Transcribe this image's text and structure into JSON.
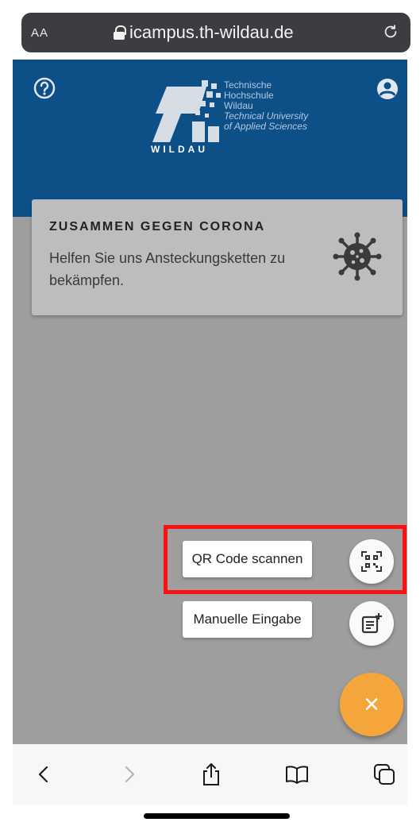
{
  "browser": {
    "text_size_button": "AA",
    "url": "icampus.th-wildau.de"
  },
  "header": {
    "logo_lines": [
      "Technische",
      "Hochschule",
      "Wildau",
      "Technical University",
      "of Applied Sciences"
    ],
    "logo_wordmark": "WILDAU"
  },
  "card": {
    "title": "ZUSAMMEN GEGEN CORONA",
    "text": "Helfen Sie uns Ansteckungsketten zu bekämpfen.",
    "icon": "virus-icon"
  },
  "actions": {
    "qr_label": "QR Code scannen",
    "manual_label": "Manuelle Eingabe",
    "close_symbol": "×"
  },
  "colors": {
    "header_blue": "#0d5088",
    "fab_orange": "#f5a63a",
    "highlight_red": "#ff1010"
  }
}
